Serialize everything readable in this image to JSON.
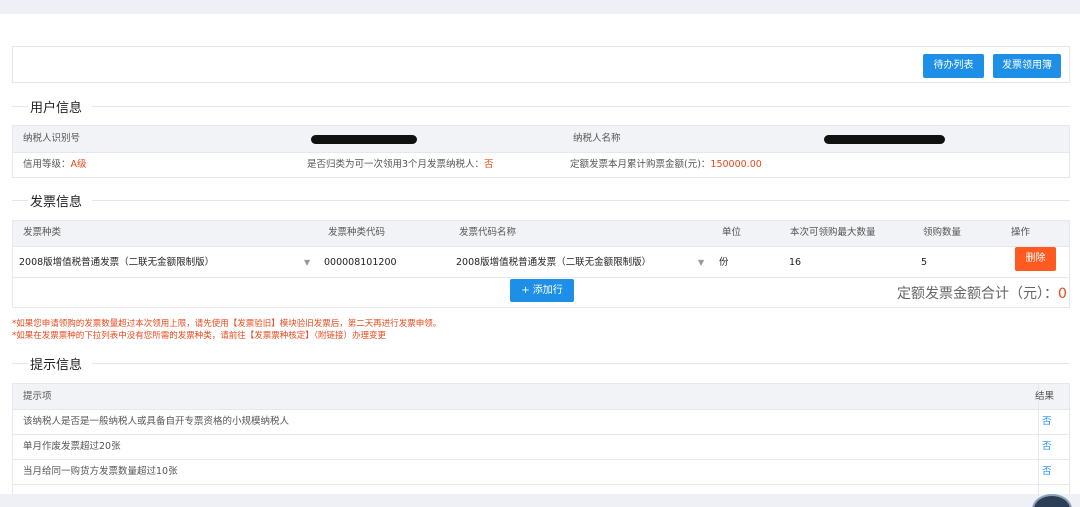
{
  "toolbar": {
    "todo_list": "待办列表",
    "invoice_register": "发票领用簿"
  },
  "user_info": {
    "title": "用户信息",
    "taxpayer_id_label": "纳税人识别号",
    "taxpayer_name_label": "纳税人名称",
    "credit_label": "信用等级：",
    "credit_value": "A级",
    "monthly_label": "是否归类为可一次领用3个月发票纳税人：",
    "monthly_value": "否",
    "fixed_amount_label": "定额发票本月累计购票金额(元)：",
    "fixed_amount_value": "150000.00"
  },
  "invoice_info": {
    "title": "发票信息",
    "columns": [
      "发票种类",
      "发票种类代码",
      "发票代码名称",
      "单位",
      "本次可领购最大数量",
      "领购数量",
      "操作"
    ],
    "row": {
      "type": "2008版增值税普通发票（二联无金额限制版）",
      "type_code": "000008101200",
      "code_name": "2008版增值税普通发票（二联无金额限制版）",
      "unit": "份",
      "max_qty": "16",
      "qty": "5",
      "delete": "删除"
    },
    "add_row": "+ 添加行",
    "total_label": "定额发票金额合计（元）：",
    "total_value": "0"
  },
  "notes": {
    "line1": "*如果您申请领购的发票数量超过本次领用上限，请先使用【发票验旧】模块验旧发票后，第二天再进行发票申领。",
    "line2": "*如果在发票票种的下拉列表中没有您所需的发票种类，请前往【发票票种核定】（附链接）办理变更"
  },
  "tips": {
    "title": "提示信息",
    "col_item": "提示项",
    "col_result": "结果",
    "rows": [
      {
        "item": "该纳税人是否是一般纳税人或具备自开专票资格的小规模纳税人",
        "result": "否"
      },
      {
        "item": "单月作废发票超过20张",
        "result": "否"
      },
      {
        "item": "当月给同一购货方发票数量超过10张",
        "result": "否"
      }
    ]
  },
  "colors": {
    "primary": "#1e8fe6",
    "danger": "#ff5a1f",
    "alert_text": "#e8491d"
  }
}
